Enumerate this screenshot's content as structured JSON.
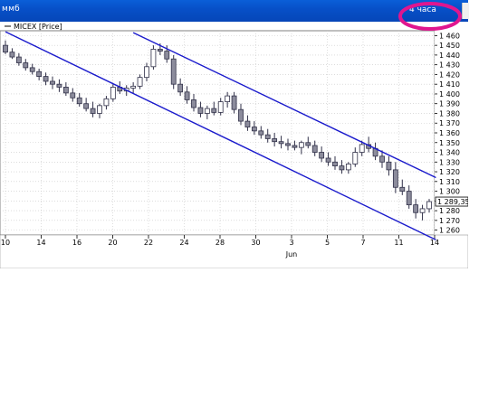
{
  "window": {
    "title": "ммб",
    "timeframe_label": "4 часа"
  },
  "legend": {
    "series_label": "MICEX [Price]"
  },
  "last_price_label": "1 289,35",
  "colors": {
    "candle_up": "#ffffff",
    "candle_down": "#8c8c9c",
    "candle_outline": "#303048",
    "channel": "#1a1acc",
    "highlight": "#e0168f",
    "grid": "#c8c8c8"
  },
  "chart_data": {
    "type": "candlestick",
    "title": "",
    "series_name": "MICEX [Price]",
    "ylim": [
      1255,
      1465
    ],
    "y_ticks": [
      1260,
      1270,
      1280,
      1290,
      1300,
      1310,
      1320,
      1330,
      1340,
      1350,
      1360,
      1370,
      1380,
      1390,
      1400,
      1410,
      1420,
      1430,
      1440,
      1450,
      1460
    ],
    "x_tick_labels": [
      "10",
      "14",
      "16",
      "20",
      "22",
      "24",
      "28",
      "30",
      "3",
      "5",
      "7",
      "11",
      "14"
    ],
    "x_secondary_label": "Jun",
    "grid": true,
    "last_value": 1289.35,
    "candles": [
      [
        1450,
        1455,
        1441,
        1443
      ],
      [
        1443,
        1447,
        1436,
        1438
      ],
      [
        1438,
        1442,
        1429,
        1432
      ],
      [
        1432,
        1436,
        1424,
        1427
      ],
      [
        1427,
        1431,
        1420,
        1423
      ],
      [
        1423,
        1426,
        1414,
        1418
      ],
      [
        1418,
        1422,
        1409,
        1413
      ],
      [
        1413,
        1418,
        1405,
        1410
      ],
      [
        1410,
        1415,
        1402,
        1407
      ],
      [
        1407,
        1412,
        1398,
        1401
      ],
      [
        1401,
        1406,
        1392,
        1396
      ],
      [
        1396,
        1401,
        1387,
        1390
      ],
      [
        1390,
        1396,
        1382,
        1385
      ],
      [
        1385,
        1392,
        1376,
        1380
      ],
      [
        1380,
        1390,
        1375,
        1388
      ],
      [
        1388,
        1398,
        1384,
        1395
      ],
      [
        1395,
        1410,
        1392,
        1407
      ],
      [
        1407,
        1413,
        1400,
        1403
      ],
      [
        1403,
        1409,
        1398,
        1406
      ],
      [
        1406,
        1412,
        1400,
        1408
      ],
      [
        1408,
        1420,
        1405,
        1417
      ],
      [
        1417,
        1432,
        1413,
        1428
      ],
      [
        1428,
        1450,
        1425,
        1446
      ],
      [
        1446,
        1452,
        1440,
        1444
      ],
      [
        1444,
        1450,
        1432,
        1436
      ],
      [
        1436,
        1440,
        1405,
        1410
      ],
      [
        1410,
        1416,
        1398,
        1402
      ],
      [
        1402,
        1408,
        1390,
        1394
      ],
      [
        1394,
        1400,
        1382,
        1386
      ],
      [
        1386,
        1392,
        1376,
        1380
      ],
      [
        1380,
        1388,
        1374,
        1385
      ],
      [
        1385,
        1392,
        1378,
        1381
      ],
      [
        1381,
        1396,
        1378,
        1392
      ],
      [
        1392,
        1402,
        1386,
        1398
      ],
      [
        1398,
        1402,
        1380,
        1384
      ],
      [
        1384,
        1390,
        1368,
        1372
      ],
      [
        1372,
        1378,
        1362,
        1366
      ],
      [
        1366,
        1372,
        1358,
        1362
      ],
      [
        1362,
        1367,
        1354,
        1358
      ],
      [
        1358,
        1364,
        1350,
        1354
      ],
      [
        1354,
        1360,
        1346,
        1351
      ],
      [
        1351,
        1357,
        1344,
        1349
      ],
      [
        1349,
        1354,
        1342,
        1347
      ],
      [
        1347,
        1352,
        1342,
        1345
      ],
      [
        1345,
        1352,
        1338,
        1350
      ],
      [
        1350,
        1356,
        1344,
        1347
      ],
      [
        1347,
        1352,
        1336,
        1340
      ],
      [
        1340,
        1346,
        1330,
        1334
      ],
      [
        1334,
        1340,
        1326,
        1330
      ],
      [
        1330,
        1336,
        1322,
        1326
      ],
      [
        1326,
        1332,
        1318,
        1322
      ],
      [
        1322,
        1330,
        1318,
        1328
      ],
      [
        1328,
        1345,
        1325,
        1340
      ],
      [
        1340,
        1352,
        1336,
        1348
      ],
      [
        1348,
        1356,
        1340,
        1344
      ],
      [
        1344,
        1350,
        1332,
        1336
      ],
      [
        1336,
        1342,
        1324,
        1330
      ],
      [
        1330,
        1336,
        1316,
        1322
      ],
      [
        1322,
        1330,
        1298,
        1304
      ],
      [
        1304,
        1312,
        1296,
        1300
      ],
      [
        1300,
        1306,
        1282,
        1286
      ],
      [
        1286,
        1292,
        1272,
        1278
      ],
      [
        1278,
        1286,
        1270,
        1282
      ],
      [
        1282,
        1292,
        1278,
        1289.35
      ]
    ],
    "channel_lines": [
      {
        "from": [
          0,
          1464
        ],
        "to": [
          64,
          1250
        ]
      },
      {
        "from": [
          19,
          1463
        ],
        "to": [
          64,
          1314
        ]
      }
    ]
  }
}
